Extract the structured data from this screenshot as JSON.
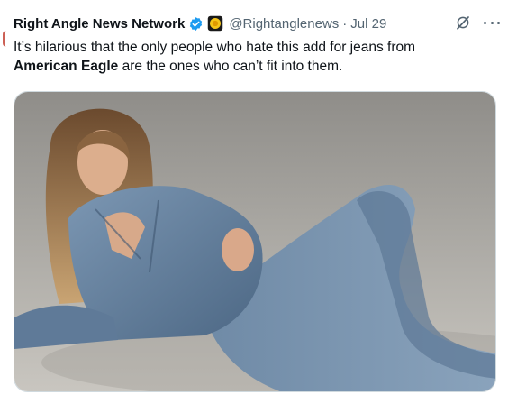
{
  "tweet": {
    "author_name": "Right Angle News Network",
    "handle": "@Rightanglenews",
    "separator": "·",
    "date": "Jul 29",
    "text_before": "It’s hilarious that the only people who hate this add for jeans from ",
    "text_bold": "American Eagle",
    "text_after": " are the ones who can’t fit into them."
  },
  "media": {
    "description": "Photo of a woman with long blonde hair wearing a denim jacket and denim jeans, reclining on a gray studio floor"
  },
  "colors": {
    "verified_badge": "#1d9bf0",
    "affiliate_badge": "#f5c518",
    "secondary_text": "#536471"
  },
  "icons": [
    "verified-badge-icon",
    "affiliate-badge-icon",
    "grok-icon",
    "more-icon"
  ]
}
